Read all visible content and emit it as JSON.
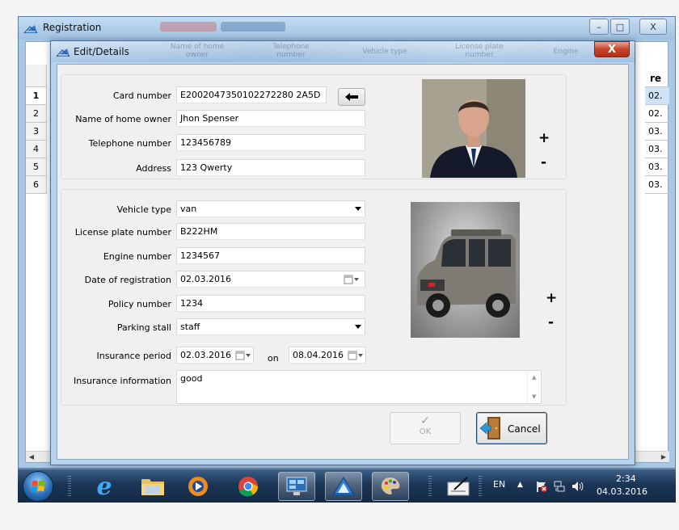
{
  "main_window": {
    "title": "Registration",
    "minimize": "–",
    "maximize": "□",
    "close": "X",
    "grid": {
      "rows": [
        "1",
        "2",
        "3",
        "4",
        "5",
        "6"
      ],
      "partial_header": "re",
      "partial_cells": [
        "02.",
        "02.",
        "03.",
        "03.",
        "03.",
        "03."
      ]
    }
  },
  "dialog": {
    "title": "Edit/Details",
    "close": "X",
    "ghost_headers": [
      "Name of home owner",
      "Telephone number",
      "Vehicle type",
      "License plate number",
      "Engine"
    ],
    "owner": {
      "card_number_label": "Card number",
      "card_number": "E2002047350102272280 2A5D",
      "name_label": "Name of home owner",
      "name": "Jhon Spenser",
      "phone_label": "Telephone number",
      "phone": "123456789",
      "address_label": "Address",
      "address": "123 Qwerty",
      "plus": "+",
      "minus": "-"
    },
    "vehicle": {
      "type_label": "Vehicle type",
      "type": "van",
      "plate_label": "License plate number",
      "plate": "B222HM",
      "engine_label": "Engine number",
      "engine": "1234567",
      "reg_date_label": "Date of registration",
      "reg_date": "02.03.2016",
      "policy_label": "Policy number",
      "policy": "1234",
      "stall_label": "Parking stall",
      "stall": "staff",
      "ins_period_label": "Insurance period",
      "ins_from": "02.03.2016",
      "on": "on",
      "ins_to": "08.04.2016",
      "ins_info_label": "Insurance information",
      "ins_info": "good",
      "plus": "+",
      "minus": "-"
    },
    "buttons": {
      "ok": "OK",
      "cancel": "Cancel"
    }
  },
  "taskbar": {
    "lang": "EN",
    "time": "2:34",
    "date": "04.03.2016"
  },
  "colors": {
    "window_frame": "#a9c8e6",
    "dialog_frame": "#b8d2ec",
    "close_red": "#c8432a",
    "taskbar": "#1b3556"
  }
}
